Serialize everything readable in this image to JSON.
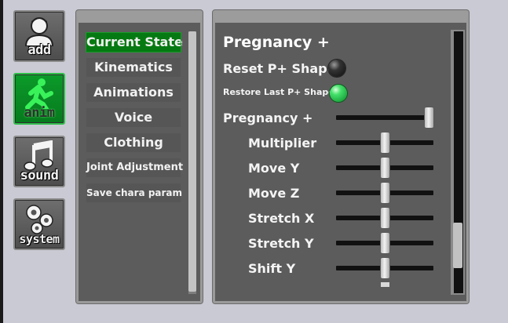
{
  "sidebar": {
    "buttons": [
      {
        "label": "add",
        "icon": "person-add-icon",
        "active": false
      },
      {
        "label": "anim",
        "icon": "running-man-icon",
        "active": true
      },
      {
        "label": "sound",
        "icon": "music-note-icon",
        "active": false
      },
      {
        "label": "system",
        "icon": "gears-icon",
        "active": false
      }
    ]
  },
  "menu": {
    "items": [
      {
        "label": "Current State",
        "selected": true
      },
      {
        "label": "Kinematics",
        "selected": false
      },
      {
        "label": "Animations",
        "selected": false
      },
      {
        "label": "Voice",
        "selected": false
      },
      {
        "label": "Clothing",
        "selected": false
      },
      {
        "label": "Joint Adjustment",
        "selected": false
      },
      {
        "label": "Save chara param",
        "selected": false
      }
    ]
  },
  "detail": {
    "title": "Pregnancy +",
    "reset_label": "Reset P+ Shape",
    "reset_state": "off",
    "restore_label": "Restore Last P+ Shape",
    "restore_state": "on",
    "main_slider": {
      "label": "Pregnancy +",
      "value": 1.0
    },
    "sliders": [
      {
        "label": "Multiplier",
        "value": 0.5
      },
      {
        "label": "Move Y",
        "value": 0.5
      },
      {
        "label": "Move Z",
        "value": 0.5
      },
      {
        "label": "Stretch X",
        "value": 0.5
      },
      {
        "label": "Stretch Y",
        "value": 0.5
      },
      {
        "label": "Shift Y",
        "value": 0.5
      }
    ]
  },
  "colors": {
    "accent_green": "#067a12",
    "active_orb": "#43e06a",
    "panel_bg": "#5c5c5c"
  }
}
